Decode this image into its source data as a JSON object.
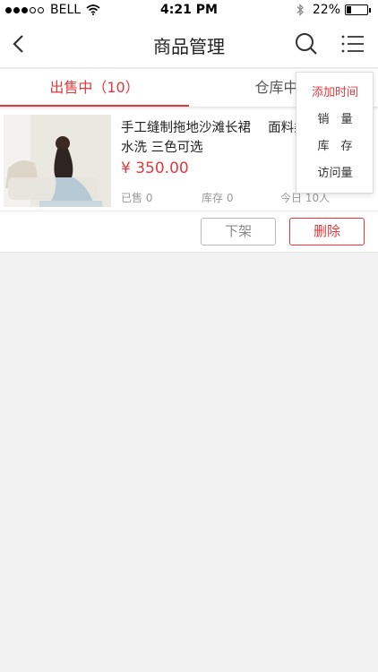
{
  "status_bar": {
    "carrier": "BELL",
    "time": "4:21 PM",
    "battery_text": "22%",
    "battery_level": 0.22
  },
  "nav": {
    "title": "商品管理"
  },
  "tabs": [
    {
      "label": "出售中（10）",
      "active": true
    },
    {
      "label": "仓库中（",
      "active": false
    }
  ],
  "product": {
    "name": "手工缝制拖地沙滩长裙　 面料柔软舒适 可水洗 三色可选",
    "price": "¥ 350.00",
    "sold": "已售 0",
    "stock": "库存 0",
    "views_today": "今日 10人",
    "unlist_label": "下架",
    "delete_label": "删除"
  },
  "sort_menu": {
    "items": [
      "添加时间",
      "销　量",
      "库　存",
      "访问量"
    ],
    "selected": "添加时间"
  },
  "colors": {
    "accent": "#e4393c",
    "background": "#f2f2f2"
  }
}
